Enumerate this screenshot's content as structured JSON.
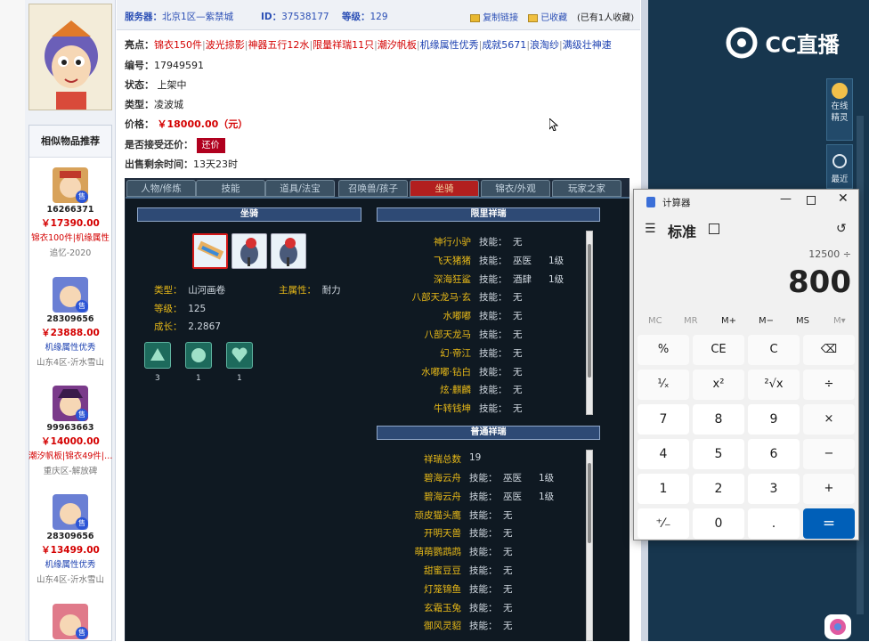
{
  "page": {
    "server_label": "服务器：",
    "server_value": "北京1区—紫禁城",
    "id_label": "ID：",
    "id_value": "37538177",
    "level_label": "等级：",
    "level_value": "129",
    "copy_link": "复制链接",
    "favorited": "已收藏",
    "fav_count": "(已有1人收藏)",
    "highlights_label": "亮点：",
    "highlights": [
      {
        "text": "锦衣150件",
        "color": "red"
      },
      {
        "text": "波光掠影",
        "color": "red"
      },
      {
        "text": "神器五行12水",
        "color": "red"
      },
      {
        "text": "限量祥瑞11只",
        "color": "red"
      },
      {
        "text": "潮汐帆板",
        "color": "red"
      },
      {
        "text": "机缘属性优秀",
        "color": "blue"
      },
      {
        "text": "成就5671",
        "color": "blue"
      },
      {
        "text": "浪淘纱",
        "color": "blue"
      },
      {
        "text": "满级壮神速",
        "color": "blue"
      }
    ],
    "serial_label": "编号：",
    "serial_value": "17949591",
    "status_label": "状态：",
    "status_value": "上架中",
    "type_label": "类型：",
    "type_value": "凌波城",
    "price_label": "价格：",
    "price_value": "￥18000.00（元）",
    "accept_offer_label": "是否接受还价：",
    "offer_button": "还价",
    "remaining_label": "出售剩余时间：",
    "remaining_value": "13天23时"
  },
  "similar": {
    "title": "相似物品推荐",
    "items": [
      {
        "id": "16266371",
        "price": "￥17390.00",
        "tags": "锦衣100件|机缘属性",
        "tags_color": "red",
        "server": "追忆-2020",
        "avatar_color": "#d8a25a"
      },
      {
        "id": "28309656",
        "price": "￥23888.00",
        "tags": "机缘属性优秀",
        "tags_color": "blue",
        "server": "山东4区-沂水雪山",
        "avatar_color": "#6a7fd4"
      },
      {
        "id": "99963663",
        "price": "￥14000.00",
        "tags": "潮汐帆板|锦衣49件|…",
        "tags_color": "red",
        "server": "重庆区-解放碑",
        "avatar_color": "#7a3a8a"
      },
      {
        "id": "28309656",
        "price": "￥13499.00",
        "tags": "机缘属性优秀",
        "tags_color": "blue",
        "server": "山东4区-沂水雪山",
        "avatar_color": "#6a7fd4"
      },
      {
        "id": "",
        "price": "",
        "tags": "",
        "tags_color": "red",
        "server": "",
        "avatar_color": "#e07a8a"
      }
    ]
  },
  "tabs": [
    "人物/修炼",
    "技能",
    "道具/法宝",
    "召唤兽/孩子",
    "坐骑",
    "锦衣/外观",
    "玩家之家"
  ],
  "active_tab": 4,
  "mount": {
    "section_title": "坐骑",
    "type_label": "类型：",
    "type_value": "山河画卷",
    "main_attr_label": "主属性：",
    "main_attr_value": "耐力",
    "level_label": "等级：",
    "level_value": "125",
    "growth_label": "成长：",
    "growth_value": "2.2867",
    "skill_counts": [
      "3",
      "1",
      "1"
    ]
  },
  "limited": {
    "title": "限里祥瑞",
    "skill_word": "技能：",
    "rows": [
      {
        "name": "神行小驴",
        "skill": "无",
        "lv": ""
      },
      {
        "name": "飞天猪猪",
        "skill": "巫医",
        "lv": "1级"
      },
      {
        "name": "深海狂鲨",
        "skill": "酒肆",
        "lv": "1级"
      },
      {
        "name": "八部天龙马·玄",
        "skill": "无",
        "lv": ""
      },
      {
        "name": "水嘟嘟",
        "skill": "无",
        "lv": ""
      },
      {
        "name": "八部天龙马",
        "skill": "无",
        "lv": ""
      },
      {
        "name": "幻·帝江",
        "skill": "无",
        "lv": ""
      },
      {
        "name": "水嘟嘟·钻白",
        "skill": "无",
        "lv": ""
      },
      {
        "name": "炫·麒麟",
        "skill": "无",
        "lv": ""
      },
      {
        "name": "牛转钱坤",
        "skill": "无",
        "lv": ""
      }
    ]
  },
  "normal": {
    "title": "普通祥瑞",
    "total_label": "祥瑞总数",
    "total_value": "19",
    "skill_word": "技能：",
    "rows": [
      {
        "name": "碧海云舟",
        "skill": "巫医",
        "lv": "1级"
      },
      {
        "name": "碧海云舟",
        "skill": "巫医",
        "lv": "1级"
      },
      {
        "name": "顽皮猫头鹰",
        "skill": "无",
        "lv": ""
      },
      {
        "name": "开明天兽",
        "skill": "无",
        "lv": ""
      },
      {
        "name": "萌萌鹦鹉鹉",
        "skill": "无",
        "lv": ""
      },
      {
        "name": "甜蜜豆豆",
        "skill": "无",
        "lv": ""
      },
      {
        "name": "灯笼锦鱼",
        "skill": "无",
        "lv": ""
      },
      {
        "name": "玄霜玉兔",
        "skill": "无",
        "lv": ""
      },
      {
        "name": "御风灵貂",
        "skill": "无",
        "lv": ""
      }
    ]
  },
  "overlay": {
    "logo_text": "CC直播",
    "online_label": "在线\n精灵",
    "recent_label": "最近"
  },
  "calculator": {
    "title": "计算器",
    "mode": "标准",
    "expression": "12500 ÷",
    "display": "800",
    "memory": [
      "MC",
      "MR",
      "M+",
      "M−",
      "MS",
      "M▾"
    ],
    "keys": [
      [
        "%",
        "CE",
        "C",
        "⌫"
      ],
      [
        "¹⁄ₓ",
        "x²",
        "²√x",
        "÷"
      ],
      [
        "7",
        "8",
        "9",
        "×"
      ],
      [
        "4",
        "5",
        "6",
        "−"
      ],
      [
        "1",
        "2",
        "3",
        "+"
      ],
      [
        "⁺⁄₋",
        "0",
        ".",
        "="
      ]
    ],
    "accent": "#005fb8"
  }
}
